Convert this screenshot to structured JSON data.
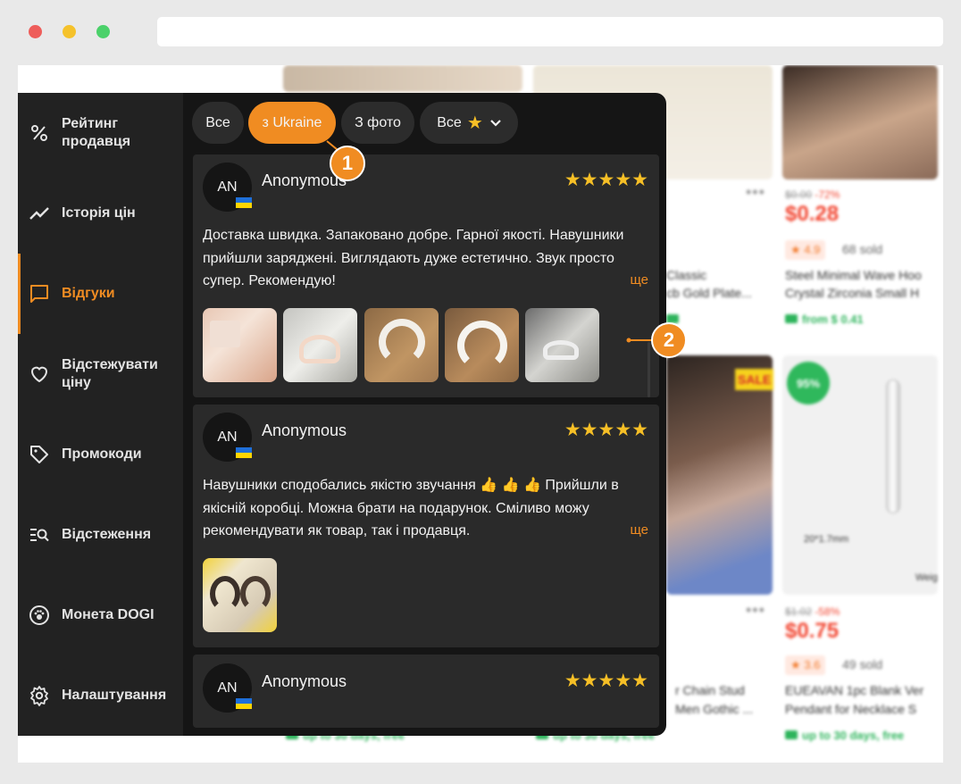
{
  "browser": {
    "url": ""
  },
  "sidebar": {
    "items": [
      {
        "label": "Рейтинг продавця",
        "icon": "percent-icon"
      },
      {
        "label": "Історія цін",
        "icon": "trend-chart-icon"
      },
      {
        "label": "Відгуки",
        "icon": "chat-bubble-icon",
        "active": true
      },
      {
        "label": "Відстежувати ціну",
        "icon": "heart-icon"
      },
      {
        "label": "Промокоди",
        "icon": "tag-icon"
      },
      {
        "label": "Відстеження",
        "icon": "tracking-list-icon"
      },
      {
        "label": "Монета DOGI",
        "icon": "coin-paw-icon"
      },
      {
        "label": "Налаштування",
        "icon": "gear-icon"
      }
    ]
  },
  "tabs": [
    {
      "label": "Все"
    },
    {
      "label": "з Ukraine",
      "active": true
    },
    {
      "label": "З фото"
    },
    {
      "label": "Все",
      "icon": "star-icon"
    }
  ],
  "reviews": [
    {
      "initials": "AN",
      "name": "Anonymous",
      "stars": "★★★★★",
      "rating": 5,
      "text": "Доставка швидка. Запаковано добре. Гарної якості. Навушники прийшли заряджені. Виглядають дуже естетично. Звук просто супер. Рекомендую!",
      "more": "ще",
      "photos": 5
    },
    {
      "initials": "AN",
      "name": "Anonymous",
      "stars": "★★★★★",
      "rating": 5,
      "text": "Навушники сподобались якістю звучання 👍 👍 👍 Прийшли в якісній коробці. Можна брати на подарунок. Сміливо можу рекомендувати як товар, так і продавця.",
      "more": "ще",
      "photos": 1
    },
    {
      "initials": "AN",
      "name": "Anonymous",
      "stars": "★★★★★",
      "rating": 5
    }
  ],
  "callouts": [
    "1",
    "2"
  ],
  "background_store": {
    "items": [
      {
        "old_price": "$0.00",
        "discount": "-72%",
        "price": "$0.28",
        "rating": "★ 4.9",
        "sold": "68 sold",
        "title_1": "Steel Minimal Wave Hoo",
        "title_2": "Crystal Zirconia Small H",
        "ship": "from $ 0.41"
      },
      {
        "old_price": "$1.02",
        "discount": "-58%",
        "price": "$0.75",
        "rating": "★ 3.6",
        "sold": "49 sold",
        "title_1": "EUEAVAN 1pc Blank Ver",
        "title_2": "Pendant for Necklace S",
        "ship": "up to 30 days, free"
      }
    ],
    "left_titles": [
      "Classic",
      "cb Gold Plate...",
      "r Chain Stud",
      "Men Gothic ..."
    ],
    "product_label": "20*1.7mm",
    "sale_badge": "SALE",
    "percent_badge": "95%",
    "weight_label": "Weig",
    "ship_bottom": "up to 30 days, free"
  },
  "colors": {
    "accent": "#f08c22",
    "panel": "#151515",
    "sidebar": "#222222",
    "card": "#2a2a2a",
    "star": "#f6bf26"
  }
}
